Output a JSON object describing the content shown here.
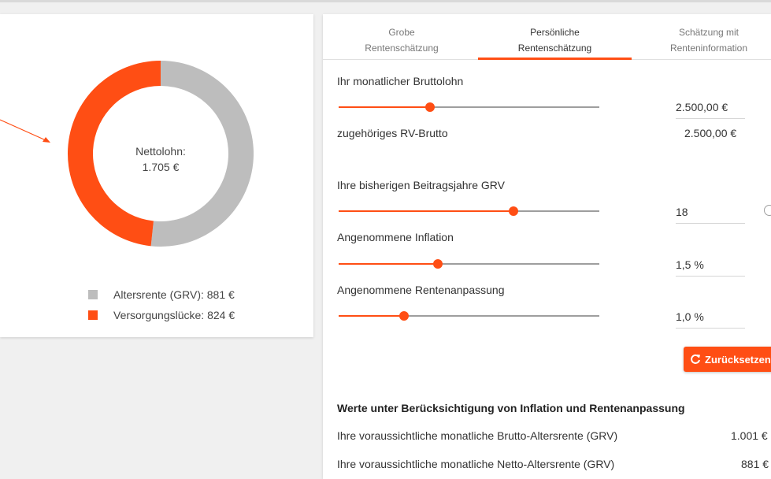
{
  "chart": {
    "center_label": "Nettolohn:",
    "center_value": "1.705 €",
    "legend": [
      {
        "label": "Altersrente (GRV): 881 €",
        "color": "#bdbdbd"
      },
      {
        "label": "Versorgungslücke: 824 €",
        "color": "#ff4e14"
      }
    ]
  },
  "chart_data": {
    "type": "pie",
    "categories": [
      "Altersrente (GRV)",
      "Versorgungslücke"
    ],
    "values": [
      881,
      824
    ],
    "colors": [
      "#bdbdbd",
      "#ff4e14"
    ],
    "title": ""
  },
  "tabs": [
    {
      "line1": "Grobe",
      "line2": "Rentenschätzung",
      "active": false
    },
    {
      "line1": "Persönliche",
      "line2": "Rentenschätzung",
      "active": true
    },
    {
      "line1": "Schätzung mit",
      "line2": "Renteninformation",
      "active": false
    }
  ],
  "form": {
    "bruttolohn": {
      "label": "Ihr monatlicher Bruttolohn",
      "value": "2.500,00 €",
      "slider_fraction": 0.35
    },
    "rv_brutto": {
      "label": "zugehöriges RV-Brutto",
      "value": "2.500,00 €"
    },
    "beitragsjahre": {
      "label": "Ihre bisherigen Beitragsjahre GRV",
      "value": "18",
      "slider_fraction": 0.67
    },
    "inflation": {
      "label": "Angenommene Inflation",
      "value": "1,5 %",
      "slider_fraction": 0.38
    },
    "rentenanpassung": {
      "label": "Angenommene Rentenanpassung",
      "value": "1,0 %",
      "slider_fraction": 0.25
    }
  },
  "reset_button": {
    "label": "Zurücksetzen"
  },
  "results": {
    "title": "Werte unter Berücksichtigung von Inflation und Rentenanpassung",
    "rows": [
      {
        "label": "Ihre voraussichtliche monatliche Brutto-Altersrente (GRV)",
        "value": "1.001 €"
      },
      {
        "label": "Ihre voraussichtliche monatliche Netto-Altersrente (GRV)",
        "value": "881 €"
      }
    ]
  },
  "colors": {
    "accent": "#ff4e14",
    "grey": "#bdbdbd"
  }
}
